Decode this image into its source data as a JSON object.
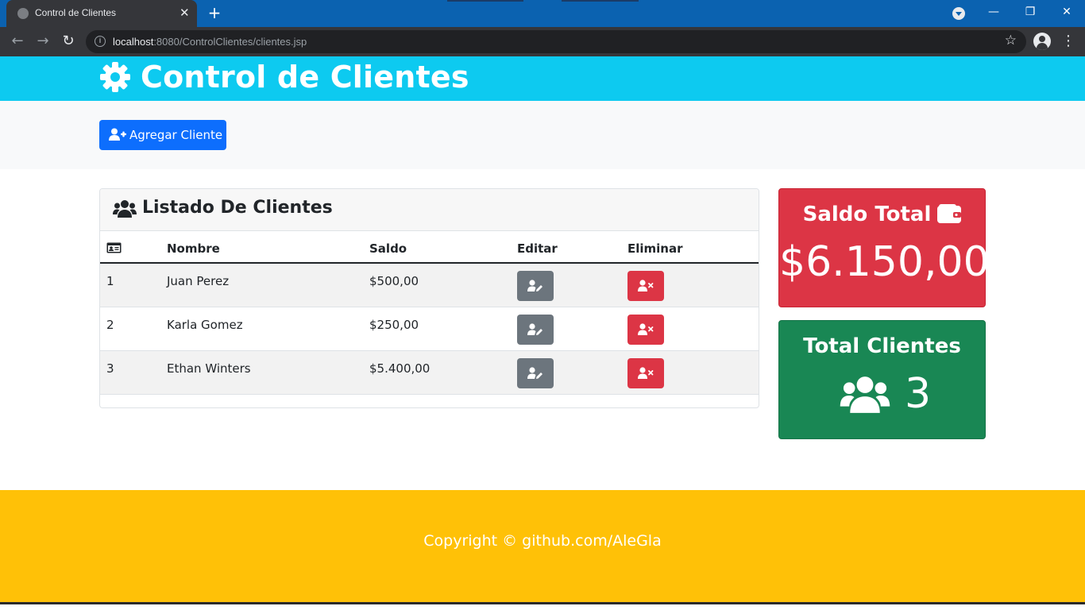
{
  "browser": {
    "tab_title": "Control de Clientes",
    "tab_close": "✕",
    "new_tab": "+",
    "url_host": "localhost",
    "url_rest": ":8080/ControlClientes/clientes.jsp",
    "window_controls": {
      "minimize": "—",
      "restore": "❐",
      "close": "✕"
    }
  },
  "header": {
    "title": "Control de Clientes",
    "icon": "gear-icon",
    "color": "#0dcaf0"
  },
  "actions": {
    "add_client_label": "Agregar Cliente",
    "icon": "user-plus-icon"
  },
  "clients_card": {
    "title": "Listado De Clientes",
    "icon": "users-icon",
    "columns": {
      "id_icon": "id-card-icon",
      "name": "Nombre",
      "balance": "Saldo",
      "edit": "Editar",
      "delete": "Eliminar"
    },
    "rows": [
      {
        "id": "1",
        "name": "Juan Perez",
        "balance": "$500,00"
      },
      {
        "id": "2",
        "name": "Karla Gomez",
        "balance": "$250,00"
      },
      {
        "id": "3",
        "name": "Ethan Winters",
        "balance": "$5.400,00"
      }
    ]
  },
  "total_balance": {
    "title": "Saldo Total",
    "value": "$6.150,00",
    "icon": "wallet-icon",
    "color": "#dc3545"
  },
  "total_clients": {
    "title": "Total Clientes",
    "value": "3",
    "icon": "users-icon",
    "color": "#198754"
  },
  "footer": {
    "text": "Copyright © github.com/AleGla",
    "color": "#ffc107"
  }
}
